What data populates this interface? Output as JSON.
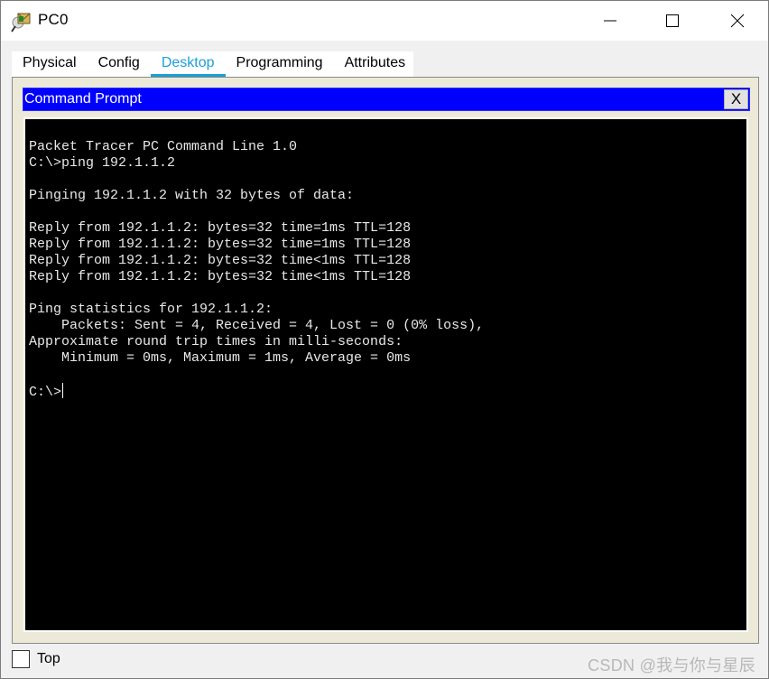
{
  "window": {
    "title": "PC0",
    "app_icon": "packet-tracer-pc-icon",
    "controls": {
      "minimize": "minimize-icon",
      "maximize": "maximize-icon",
      "close": "close-icon"
    }
  },
  "tabs": [
    {
      "label": "Physical",
      "active": false
    },
    {
      "label": "Config",
      "active": false
    },
    {
      "label": "Desktop",
      "active": true
    },
    {
      "label": "Programming",
      "active": false
    },
    {
      "label": "Attributes",
      "active": false
    }
  ],
  "command_prompt": {
    "title": "Command Prompt",
    "close_label": "X",
    "lines": [
      "Packet Tracer PC Command Line 1.0",
      "C:\\>ping 192.1.1.2",
      "",
      "Pinging 192.1.1.2 with 32 bytes of data:",
      "",
      "Reply from 192.1.1.2: bytes=32 time=1ms TTL=128",
      "Reply from 192.1.1.2: bytes=32 time=1ms TTL=128",
      "Reply from 192.1.1.2: bytes=32 time<1ms TTL=128",
      "Reply from 192.1.1.2: bytes=32 time<1ms TTL=128",
      "",
      "Ping statistics for 192.1.1.2:",
      "    Packets: Sent = 4, Received = 4, Lost = 0 (0% loss),",
      "Approximate round trip times in milli-seconds:",
      "    Minimum = 0ms, Maximum = 1ms, Average = 0ms",
      ""
    ],
    "prompt": "C:\\>"
  },
  "footer": {
    "top_label": "Top",
    "top_checked": false,
    "watermark": "CSDN @我与你与星辰"
  },
  "colors": {
    "accent_tab": "#1a9fd8",
    "cmd_header": "#0000ff",
    "terminal_bg": "#000000",
    "terminal_fg": "#e8e8e8",
    "panel_bg": "#ece9d8"
  }
}
